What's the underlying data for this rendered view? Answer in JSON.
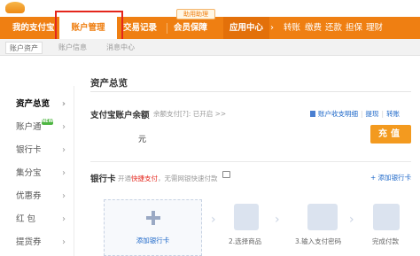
{
  "main_nav": {
    "items": [
      "我的支付宝",
      "账户管理",
      "交易记录",
      "会员保障",
      "应用中心",
      "转账",
      "缴费",
      "还款",
      "担保",
      "理财"
    ],
    "badge": "助用助理",
    "more_glyph": "›"
  },
  "sub_nav": {
    "items": [
      "账户资产",
      "账户信息",
      "消息中心"
    ]
  },
  "sidebar": {
    "items": [
      "资产总览",
      "账户通",
      "银行卡",
      "集分宝",
      "优惠券",
      "红 包",
      "提货券"
    ],
    "new_badge": "NEW"
  },
  "main": {
    "title": "资产总览",
    "balance": {
      "label": "支付宝账户余额",
      "status": "余额支付[?]: 已开启 >>",
      "links": [
        "账户收支明细",
        "提现",
        "转账"
      ],
      "amount_unit": "元",
      "recharge_label": "充值"
    },
    "bank": {
      "label": "银行卡",
      "desc_prefix": "开通",
      "desc_highlight": "快捷支付",
      "desc_suffix": "，无需网银快速付款",
      "add_link": "+ 添加银行卡",
      "add_box_label": "添加银行卡",
      "steps": [
        "2.选择商品",
        "3.输入支付密码",
        "完成付款"
      ]
    }
  },
  "colors": {
    "brand": "#ef7f12",
    "link": "#1b66c8",
    "highlight": "#e4261c",
    "button": "#f39a1f"
  }
}
